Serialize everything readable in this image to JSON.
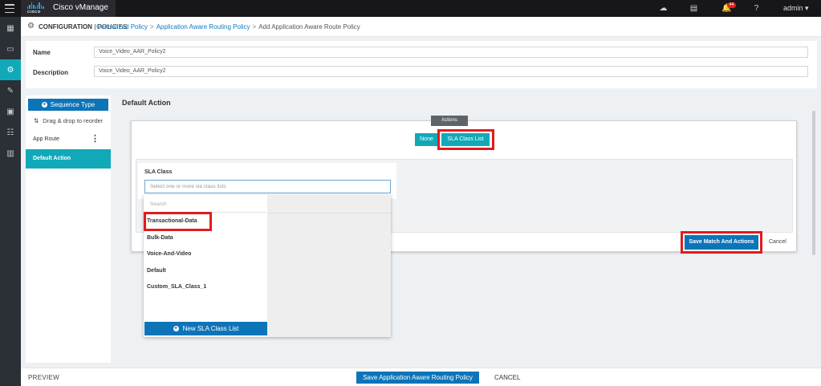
{
  "app": {
    "brand": "Cisco vManage",
    "logo_text": "CISCO"
  },
  "topbar": {
    "notification_count": "44",
    "user": "admin"
  },
  "header": {
    "section": "CONFIGURATION",
    "subsection": "| POLICIES",
    "breadcrumbs": [
      "Centralized Policy",
      "Application Aware Routing Policy",
      "Add Application Aware Route Policy"
    ],
    "separator": ">"
  },
  "form": {
    "name_label": "Name",
    "name_value": "Voice_Video_AAR_Policy2",
    "description_label": "Description",
    "description_value": "Voice_Video_AAR_Policy2"
  },
  "sequence_panel": {
    "sequence_type_label": "Sequence Type",
    "drag_hint": "Drag & drop to reorder",
    "items": [
      "App Route",
      "Default Action"
    ]
  },
  "default_action": {
    "title": "Default Action",
    "actions_label": "Actions",
    "none_button": "None",
    "sla_class_list_button": "SLA Class List",
    "sla_class_label": "SLA Class",
    "sla_class_placeholder": "Select one or more sla class lists",
    "dropdown": {
      "search_placeholder": "Search",
      "options": [
        "Transactional-Data",
        "Bulk-Data",
        "Voice-And-Video",
        "Default",
        "Custom_SLA_Class_1"
      ],
      "new_button": "New SLA Class List"
    },
    "save_button": "Save Match And Actions",
    "cancel_button": "Cancel"
  },
  "footer": {
    "preview": "PREVIEW",
    "save": "Save Application Aware Routing Policy",
    "cancel": "CANCEL"
  },
  "colors": {
    "accent_teal": "#11a9b8",
    "primary_blue": "#0d74b8",
    "highlight_red": "#e01c1c",
    "topbar": "#17171a"
  }
}
